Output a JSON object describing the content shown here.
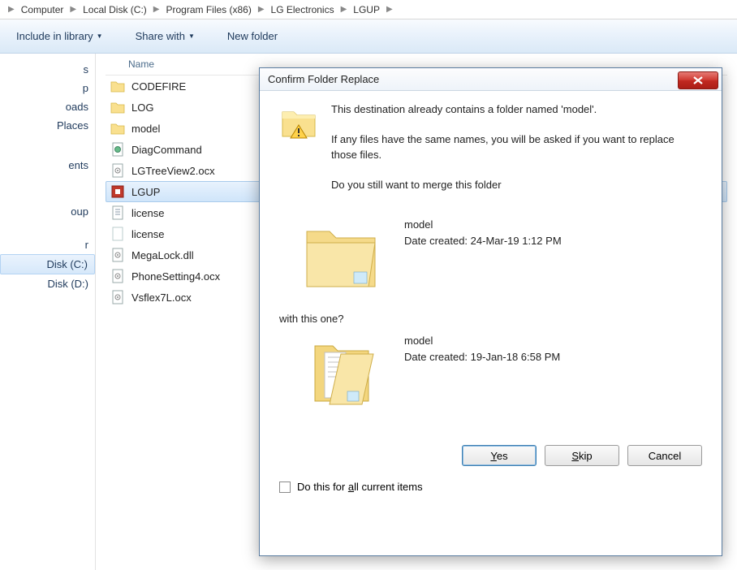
{
  "breadcrumb": {
    "items": [
      "Computer",
      "Local Disk (C:)",
      "Program Files (x86)",
      "LG Electronics",
      "LGUP"
    ]
  },
  "toolbar": {
    "include": "Include in library",
    "share": "Share with",
    "new_folder": "New folder"
  },
  "sidebar": {
    "items": [
      {
        "label": "s"
      },
      {
        "label": "p"
      },
      {
        "label": "oads"
      },
      {
        "label": "Places"
      },
      {
        "spacer": true
      },
      {
        "label": ""
      },
      {
        "label": "ents"
      },
      {
        "label": ""
      },
      {
        "label": ""
      },
      {
        "spacer": true
      },
      {
        "label": "oup"
      },
      {
        "spacer": true
      },
      {
        "label": "r"
      },
      {
        "label": "Disk (C:)",
        "selected": true
      },
      {
        "label": "Disk (D:)"
      }
    ]
  },
  "filelist": {
    "col_name": "Name",
    "rows": [
      {
        "icon": "folder",
        "name": "CODEFIRE"
      },
      {
        "icon": "folder",
        "name": "LOG"
      },
      {
        "icon": "folder",
        "name": "model"
      },
      {
        "icon": "file-cfg",
        "name": "DiagCommand"
      },
      {
        "icon": "file-ocx",
        "name": "LGTreeView2.ocx"
      },
      {
        "icon": "file-exe",
        "name": "LGUP",
        "selected": true
      },
      {
        "icon": "file-txt",
        "name": "license"
      },
      {
        "icon": "file-blank",
        "name": "license"
      },
      {
        "icon": "file-ocx",
        "name": "MegaLock.dll"
      },
      {
        "icon": "file-ocx",
        "name": "PhoneSetting4.ocx"
      },
      {
        "icon": "file-ocx",
        "name": "Vsflex7L.ocx"
      }
    ]
  },
  "dialog": {
    "title": "Confirm Folder Replace",
    "line1": "This destination already contains a folder named 'model'.",
    "line2": "If any files have the same names, you will be asked if you want to replace those files.",
    "line3": "Do you still want to merge this folder",
    "dest": {
      "name": "model",
      "date": "Date created: 24-Mar-19 1:12 PM"
    },
    "with_label": "with this one?",
    "src": {
      "name": "model",
      "date": "Date created: 19-Jan-18 6:58 PM"
    },
    "btn_yes": "Yes",
    "btn_skip": "Skip",
    "btn_cancel": "Cancel",
    "chk_label_pre": "Do this for ",
    "chk_label_u": "a",
    "chk_label_post": "ll current items"
  }
}
